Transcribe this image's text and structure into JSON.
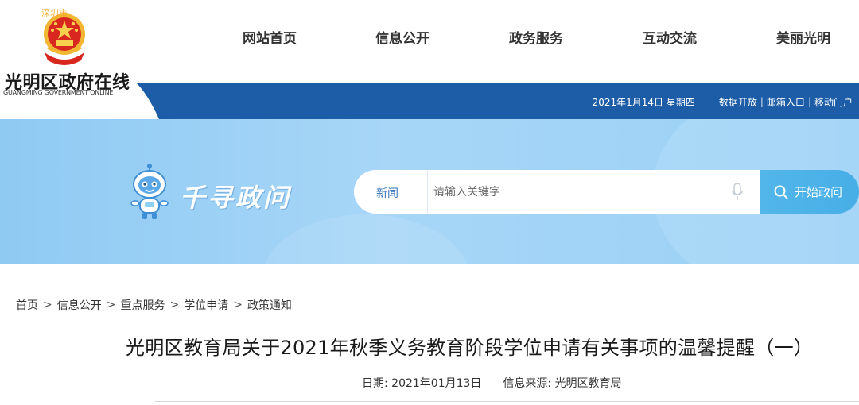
{
  "header": {
    "site_title": "光明区政府在线",
    "site_subtitle": "GUANGMING GOVERNMENT ONLINE",
    "emblem_overlay_text": "深圳市",
    "nav": [
      {
        "label": "网站首页"
      },
      {
        "label": "信息公开"
      },
      {
        "label": "政务服务"
      },
      {
        "label": "互动交流"
      },
      {
        "label": "美丽光明"
      }
    ],
    "utility": {
      "date": "2021年1月14日 星期四",
      "links": [
        "数据开放",
        "邮箱入口",
        "移动门户"
      ],
      "separator": "|"
    }
  },
  "banner": {
    "brand_text": "千寻政问",
    "search": {
      "category": "新闻",
      "placeholder": "请输入关键字",
      "value": "",
      "button_label": "开始政问",
      "button_icon": "search-icon",
      "mic_icon": "microphone-icon"
    }
  },
  "breadcrumb": {
    "items": [
      "首页",
      "信息公开",
      "重点服务",
      "学位申请",
      "政策通知"
    ],
    "separator": ">"
  },
  "article": {
    "title": "光明区教育局关于2021年秋季义务教育阶段学位申请有关事项的温馨提醒（一）",
    "date_label": "日期:",
    "date_value": "2021年01月13日",
    "source_label": "信息来源:",
    "source_value": "光明区教育局"
  },
  "colors": {
    "header_band": "#1d5da8",
    "banner_bg": "#a7d6f7",
    "search_button": "#4db2e8",
    "search_category": "#2f6fb6"
  }
}
